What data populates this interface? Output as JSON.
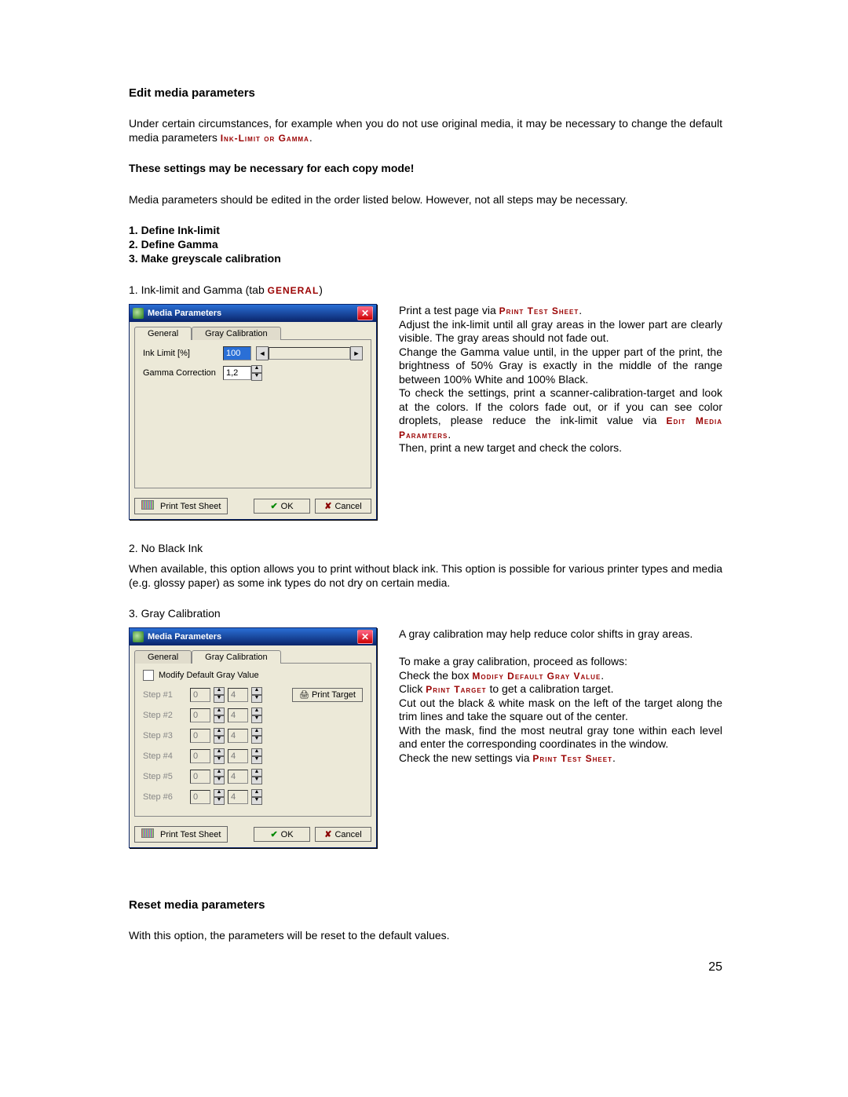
{
  "page_number": "25",
  "headings": {
    "edit": "Edit media parameters",
    "reset": "Reset media parameters"
  },
  "text": {
    "intro_a": "Under certain circumstances, for example when you do not use original media, it may be necessary to change the default media parameters ",
    "intro_red": "Ink-Limit or Gamma",
    "intro_b": ".",
    "warn": "These settings may be necessary for each copy mode!",
    "order": "Media parameters should be edited in the order listed below. However, not all steps may be necessary.",
    "steps": [
      "1. Define Ink-limit",
      "2. Define Gamma",
      "3. Make greyscale calibration"
    ],
    "sub1_label": "1. Ink-limit and Gamma (tab ",
    "sub1_red": "GENERAL",
    "sub1_b": ")",
    "right1_a": "Print a test page via ",
    "right1_red1": "Print Test Sheet",
    "right1_b": ".",
    "right1_c": "Adjust the ink-limit until all gray areas in the lower part are clearly visible. The gray areas should not fade out.",
    "right1_d": "Change the Gamma value until, in the upper part of the print, the brightness of 50% Gray is exactly in the middle of the range between 100% White and 100% Black.",
    "right1_e": "To check the settings, print a scanner-calibration-target and look at the colors. If the colors fade out, or if you can see color droplets, please reduce the ink-limit value via ",
    "right1_red2": "Edit Media Paramters",
    "right1_f": ".",
    "right1_g": "Then, print a new target and check the colors.",
    "sub2_label": "2. No Black Ink",
    "sub2_body": "When available, this option allows you to print without black ink. This option is possible for various printer types and media (e.g. glossy paper) as some ink types do not dry on certain media.",
    "sub3_label": "3. Gray Calibration",
    "right3_a": "A gray calibration may help reduce color shifts in gray areas.",
    "right3_b": "To make a gray calibration, proceed as follows:",
    "right3_c_pre": "Check the box ",
    "right3_red1": "Modify Default Gray Value",
    "right3_c_post": ".",
    "right3_d_pre": "Click ",
    "right3_red2": "Print Target",
    "right3_d_post": " to get a calibration target.",
    "right3_e": "Cut out the black & white mask on the left of the target along the trim lines and take the square out of the center.",
    "right3_f": "With the mask, find the most neutral gray tone within each level and enter the corresponding coordinates in the window.",
    "right3_g_pre": "Check the new settings via ",
    "right3_red3": "Print Test Sheet",
    "right3_g_post": ".",
    "reset_body": "With this option, the parameters will be reset to the default values."
  },
  "dialog1": {
    "title": "Media Parameters",
    "tabs": {
      "general": "General",
      "gray": "Gray Calibration"
    },
    "ink_label": "Ink Limit [%]",
    "ink_value": "100",
    "gamma_label": "Gamma Correction",
    "gamma_value": "1,2",
    "btn_print": "Print Test Sheet",
    "btn_ok": "OK",
    "btn_cancel": "Cancel"
  },
  "dialog2": {
    "title": "Media Parameters",
    "tabs": {
      "general": "General",
      "gray": "Gray Calibration"
    },
    "checkbox": "Modify Default Gray Value",
    "rows": [
      {
        "label": "Step #1",
        "a": "0",
        "b": "4"
      },
      {
        "label": "Step #2",
        "a": "0",
        "b": "4"
      },
      {
        "label": "Step #3",
        "a": "0",
        "b": "4"
      },
      {
        "label": "Step #4",
        "a": "0",
        "b": "4"
      },
      {
        "label": "Step #5",
        "a": "0",
        "b": "4"
      },
      {
        "label": "Step #6",
        "a": "0",
        "b": "4"
      }
    ],
    "btn_target": "Print Target",
    "btn_print": "Print Test Sheet",
    "btn_ok": "OK",
    "btn_cancel": "Cancel"
  }
}
